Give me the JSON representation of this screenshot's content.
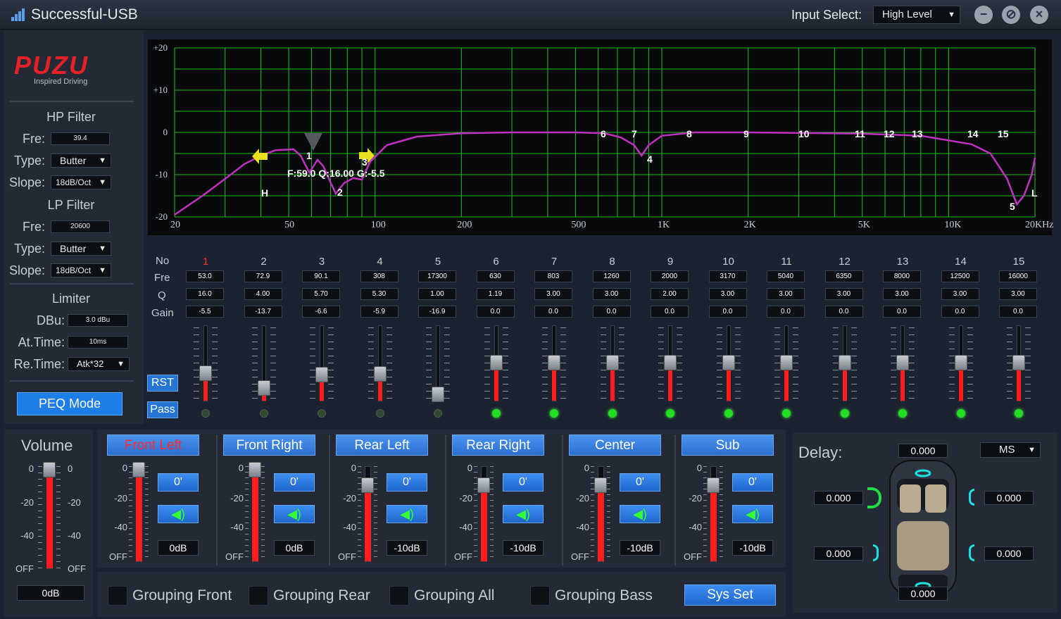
{
  "title": "Successful-USB",
  "input_select": {
    "label": "Input Select:",
    "value": "High Level"
  },
  "brand": {
    "logo": "PUZU",
    "tagline": "Inspired Driving"
  },
  "hp": {
    "title": "HP Filter",
    "fre_label": "Fre:",
    "fre": "39.4",
    "type_label": "Type:",
    "type": "Butter",
    "slope_label": "Slope:",
    "slope": "18dB/Oct"
  },
  "lp": {
    "title": "LP Filter",
    "fre_label": "Fre:",
    "fre": "20600",
    "type_label": "Type:",
    "type": "Butter",
    "slope_label": "Slope:",
    "slope": "18dB/Oct"
  },
  "limiter": {
    "title": "Limiter",
    "dbu_label": "DBu:",
    "dbu": "3.0 dBu",
    "at_label": "At.Time:",
    "at": "10ms",
    "re_label": "Re.Time:",
    "re": "Atk*32"
  },
  "peq_button": "PEQ Mode",
  "graph": {
    "y_ticks": [
      "+20",
      "+10",
      "0",
      "-10",
      "-20"
    ],
    "x_ticks": [
      "20",
      "50",
      "100",
      "200",
      "500",
      "1K",
      "2K",
      "5K",
      "10K",
      "20KHz"
    ],
    "annotation": "F:59.0 Q:16.00 G:-5.5",
    "hp_marker": "H",
    "lp_marker": "L",
    "point_labels": [
      "1",
      "2",
      "3",
      "4",
      "5",
      "6",
      "7",
      "8",
      "9",
      "10",
      "11",
      "12",
      "13",
      "14",
      "15"
    ]
  },
  "eq": {
    "row_labels": [
      "No",
      "Fre",
      "Q",
      "Gain"
    ],
    "rst": "RST",
    "pass": "Pass",
    "bands": [
      {
        "no": "1",
        "fre": "53.0",
        "q": "16.0",
        "gain": "-5.5",
        "level": 0.36,
        "on": false
      },
      {
        "no": "2",
        "fre": "72.9",
        "q": "4.00",
        "gain": "-13.7",
        "level": 0.16,
        "on": false
      },
      {
        "no": "3",
        "fre": "90.1",
        "q": "5.70",
        "gain": "-6.6",
        "level": 0.34,
        "on": false
      },
      {
        "no": "4",
        "fre": "308",
        "q": "5.30",
        "gain": "-5.9",
        "level": 0.35,
        "on": false
      },
      {
        "no": "5",
        "fre": "17300",
        "q": "1.00",
        "gain": "-16.9",
        "level": 0.08,
        "on": false
      },
      {
        "no": "6",
        "fre": "630",
        "q": "1.19",
        "gain": "0.0",
        "level": 0.5,
        "on": true
      },
      {
        "no": "7",
        "fre": "803",
        "q": "3.00",
        "gain": "0.0",
        "level": 0.5,
        "on": true
      },
      {
        "no": "8",
        "fre": "1260",
        "q": "3.00",
        "gain": "0.0",
        "level": 0.5,
        "on": true
      },
      {
        "no": "9",
        "fre": "2000",
        "q": "2.00",
        "gain": "0.0",
        "level": 0.5,
        "on": true
      },
      {
        "no": "10",
        "fre": "3170",
        "q": "3.00",
        "gain": "0.0",
        "level": 0.5,
        "on": true
      },
      {
        "no": "11",
        "fre": "5040",
        "q": "3.00",
        "gain": "0.0",
        "level": 0.5,
        "on": true
      },
      {
        "no": "12",
        "fre": "6350",
        "q": "3.00",
        "gain": "0.0",
        "level": 0.5,
        "on": true
      },
      {
        "no": "13",
        "fre": "8000",
        "q": "3.00",
        "gain": "0.0",
        "level": 0.5,
        "on": true
      },
      {
        "no": "14",
        "fre": "12500",
        "q": "3.00",
        "gain": "0.0",
        "level": 0.5,
        "on": true
      },
      {
        "no": "15",
        "fre": "16000",
        "q": "3.00",
        "gain": "0.0",
        "level": 0.5,
        "on": true
      }
    ]
  },
  "volume": {
    "title": "Volume",
    "value": "0dB",
    "ticks": [
      "0",
      "-20",
      "-40",
      "OFF"
    ],
    "level": 1.0
  },
  "channels": [
    {
      "name": "Front Left",
      "phase": "0'",
      "db": "0dB",
      "active": true,
      "level": 1.0
    },
    {
      "name": "Front Right",
      "phase": "0'",
      "db": "0dB",
      "active": false,
      "level": 1.0
    },
    {
      "name": "Rear Left",
      "phase": "0'",
      "db": "-10dB",
      "active": false,
      "level": 0.84
    },
    {
      "name": "Rear Right",
      "phase": "0'",
      "db": "-10dB",
      "active": false,
      "level": 0.84
    },
    {
      "name": "Center",
      "phase": "0'",
      "db": "-10dB",
      "active": false,
      "level": 0.84
    },
    {
      "name": "Sub",
      "phase": "0'",
      "db": "-10dB",
      "active": false,
      "level": 0.84
    }
  ],
  "fader_ticks": [
    "0",
    "-20",
    "-40",
    "OFF"
  ],
  "grouping": [
    "Grouping Front",
    "Grouping Rear",
    "Grouping All",
    "Grouping Bass"
  ],
  "sys_set": "Sys Set",
  "delay": {
    "label": "Delay:",
    "unit": "MS",
    "top": "0.000",
    "front_left": "0.000",
    "front_right": "0.000",
    "rear_left": "0.000",
    "rear_right": "0.000",
    "bottom": "0.000"
  },
  "colors": {
    "accent": "#2475d4",
    "curve": "#c030c0",
    "grid": "#20c020",
    "fill": "#ff1c1c",
    "led_on": "#22dd22"
  }
}
